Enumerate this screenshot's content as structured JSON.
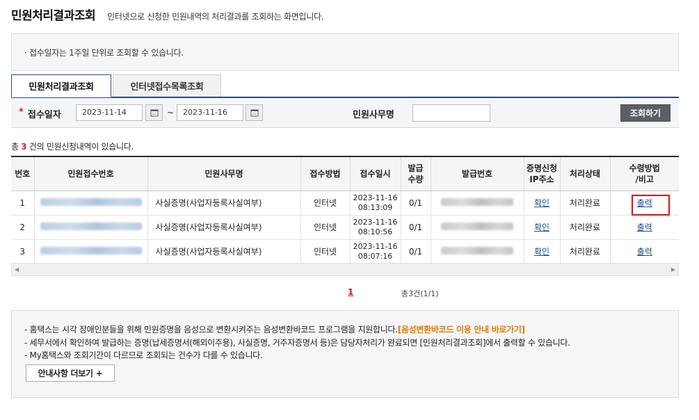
{
  "page": {
    "title": "민원처리결과조회",
    "description": "인터넷으로 신청한 민원내역의 처리결과를 조회하는 화면입니다."
  },
  "notice": "· 접수일자는 1주일 단위로 조회할 수 있습니다.",
  "tabs": [
    {
      "label": "민원처리결과조회",
      "active": true
    },
    {
      "label": "인터넷접수목록조회",
      "active": false
    }
  ],
  "search": {
    "required_mark": "*",
    "date_label": "접수일자",
    "date_from": "2023-11-14",
    "date_to": "2023-11-16",
    "tilde": "~",
    "office_label": "민원사무명",
    "office_value": "",
    "search_button": "조회하기"
  },
  "summary": {
    "prefix": "총",
    "count": "3",
    "suffix": "건의 민원신청내역이 있습니다."
  },
  "table": {
    "headers": [
      "번호",
      "민원접수번호",
      "민원사무명",
      "접수방법",
      "접수일시",
      "발급\n수량",
      "발급번호",
      "증명신청\nIP주소",
      "처리상태",
      "수령방법\n/비고"
    ],
    "rows": [
      {
        "no": "1",
        "office": "사실증명(사업자등록사실여부)",
        "method": "인터넷",
        "date": "2023-11-16",
        "time": "08:13:09",
        "qty": "0/1",
        "ip": "확인",
        "status": "처리완료",
        "receipt": "출력"
      },
      {
        "no": "2",
        "office": "사실증명(사업자등록사실여부)",
        "method": "인터넷",
        "date": "2023-11-16",
        "time": "08:10:56",
        "qty": "0/1",
        "ip": "확인",
        "status": "처리완료",
        "receipt": "출력"
      },
      {
        "no": "3",
        "office": "사실증명(사업자등록사실여부)",
        "method": "인터넷",
        "date": "2023-11-16",
        "time": "08:07:16",
        "qty": "0/1",
        "ip": "확인",
        "status": "처리완료",
        "receipt": "출력"
      }
    ]
  },
  "pagination": {
    "current": "1",
    "total_text": "총3건(1/1)"
  },
  "info": {
    "line1_text": "- 홈택스는 시각 장애인분들을 위해 민원증명을 음성으로 변환시켜주는 음성변환바코드 프로그램을 지원합니다.",
    "line1_link": "[음성변환바코드 이용 안내 바로가기]",
    "line2": "- 세무서에서 확인하여 발급하는 증명(납세증명서(해외이주용), 사실증명, 거주자증명서 등)은 담당자처리가 완료되면 [민원처리결과조회]에서 출력할 수 있습니다.",
    "line3": "- My홈택스와 조회기간이 다르므로 조회되는 건수가 다를 수 있습니다.",
    "more_button": "안내사항 더보기 +"
  },
  "colors": {
    "accent": "#2a4c78",
    "highlight": "#e01010",
    "link": "#1a4f8a",
    "orange_link": "#e07a00"
  }
}
